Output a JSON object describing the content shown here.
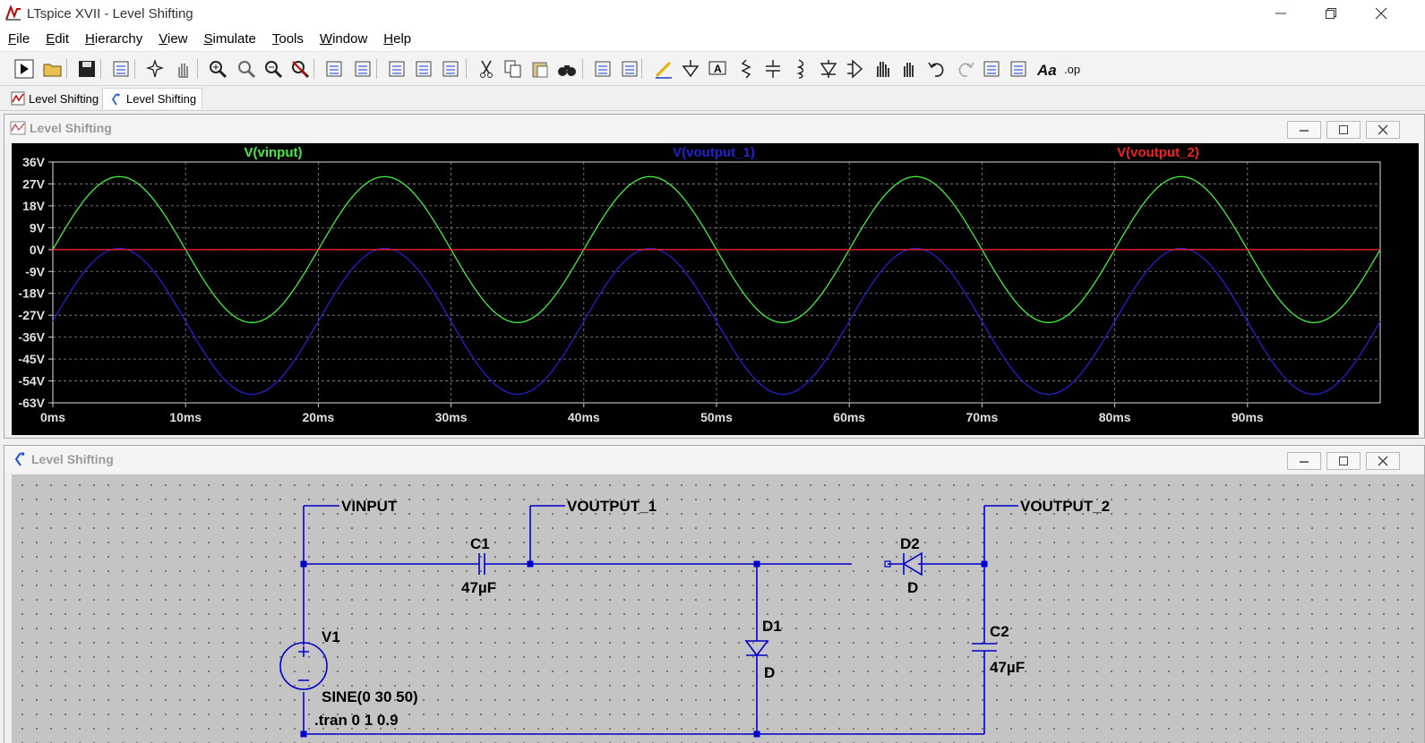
{
  "window": {
    "title": "LTspice XVII - Level Shifting"
  },
  "menu": [
    "File",
    "Edit",
    "Hierarchy",
    "View",
    "Simulate",
    "Tools",
    "Window",
    "Help"
  ],
  "menu_mnemonic": [
    "F",
    "E",
    "H",
    "V",
    "S",
    "T",
    "W",
    "H"
  ],
  "toolbar_icons": [
    "run-icon",
    "open-icon",
    "save-icon",
    "control-panel-icon",
    "halt-icon",
    "pan-hand-icon",
    "zoom-in-icon",
    "zoom-area-icon",
    "zoom-out-icon",
    "zoom-cancel-icon",
    "autorange-icon",
    "plot-settings-icon",
    "tile-horizontal-icon",
    "cascade-icon",
    "tile-vertical-icon",
    "cut-icon",
    "copy-icon",
    "paste-icon",
    "find-icon",
    "print-preview-icon",
    "print-icon",
    "draw-wire-icon",
    "ground-icon",
    "label-net-icon",
    "resistor-icon",
    "capacitor-icon",
    "inductor-icon",
    "diode-icon",
    "component-icon",
    "move-icon",
    "drag-icon",
    "undo-icon",
    "redo-icon",
    "rotate-icon",
    "mirror-icon",
    "text-icon",
    "spice-directive-icon"
  ],
  "tabs": [
    {
      "label": "Level Shifting",
      "icon": "waveform-icon",
      "active": false
    },
    {
      "label": "Level Shifting",
      "icon": "schematic-icon",
      "active": true
    }
  ],
  "plot_window": {
    "title": "Level Shifting"
  },
  "schematic_window": {
    "title": "Level Shifting"
  },
  "chart_data": {
    "type": "line",
    "x_ticks": [
      "0ms",
      "10ms",
      "20ms",
      "30ms",
      "40ms",
      "50ms",
      "60ms",
      "70ms",
      "80ms",
      "90ms"
    ],
    "y_ticks": [
      "36V",
      "27V",
      "18V",
      "9V",
      "0V",
      "-9V",
      "-18V",
      "-27V",
      "-36V",
      "-45V",
      "-54V",
      "-63V"
    ],
    "xlim": [
      0,
      100
    ],
    "ylim": [
      -63,
      36
    ],
    "grid": true,
    "legend": "top",
    "series": [
      {
        "name": "V(vinput)",
        "color": "#44ee44",
        "kind": "sine",
        "amplitude": 30,
        "offset": 0,
        "frequency_hz": 50
      },
      {
        "name": "V(voutput_1)",
        "color": "#2222cc",
        "kind": "sine",
        "amplitude": 30,
        "offset": -29.5,
        "frequency_hz": 50
      },
      {
        "name": "V(voutput_2)",
        "color": "#ee2222",
        "kind": "constant",
        "value": 0
      }
    ]
  },
  "schematic": {
    "net_labels": [
      "VINPUT",
      "VOUTPUT_1",
      "VOUTPUT_2"
    ],
    "c1": {
      "name": "C1",
      "value": "47µF"
    },
    "c2": {
      "name": "C2",
      "value": "47µF"
    },
    "d1": {
      "name": "D1",
      "model": "D"
    },
    "d2": {
      "name": "D2",
      "model": "D"
    },
    "v1": {
      "name": "V1",
      "value": "SINE(0 30 50)"
    },
    "directive": ".tran 0 1 0.9"
  }
}
